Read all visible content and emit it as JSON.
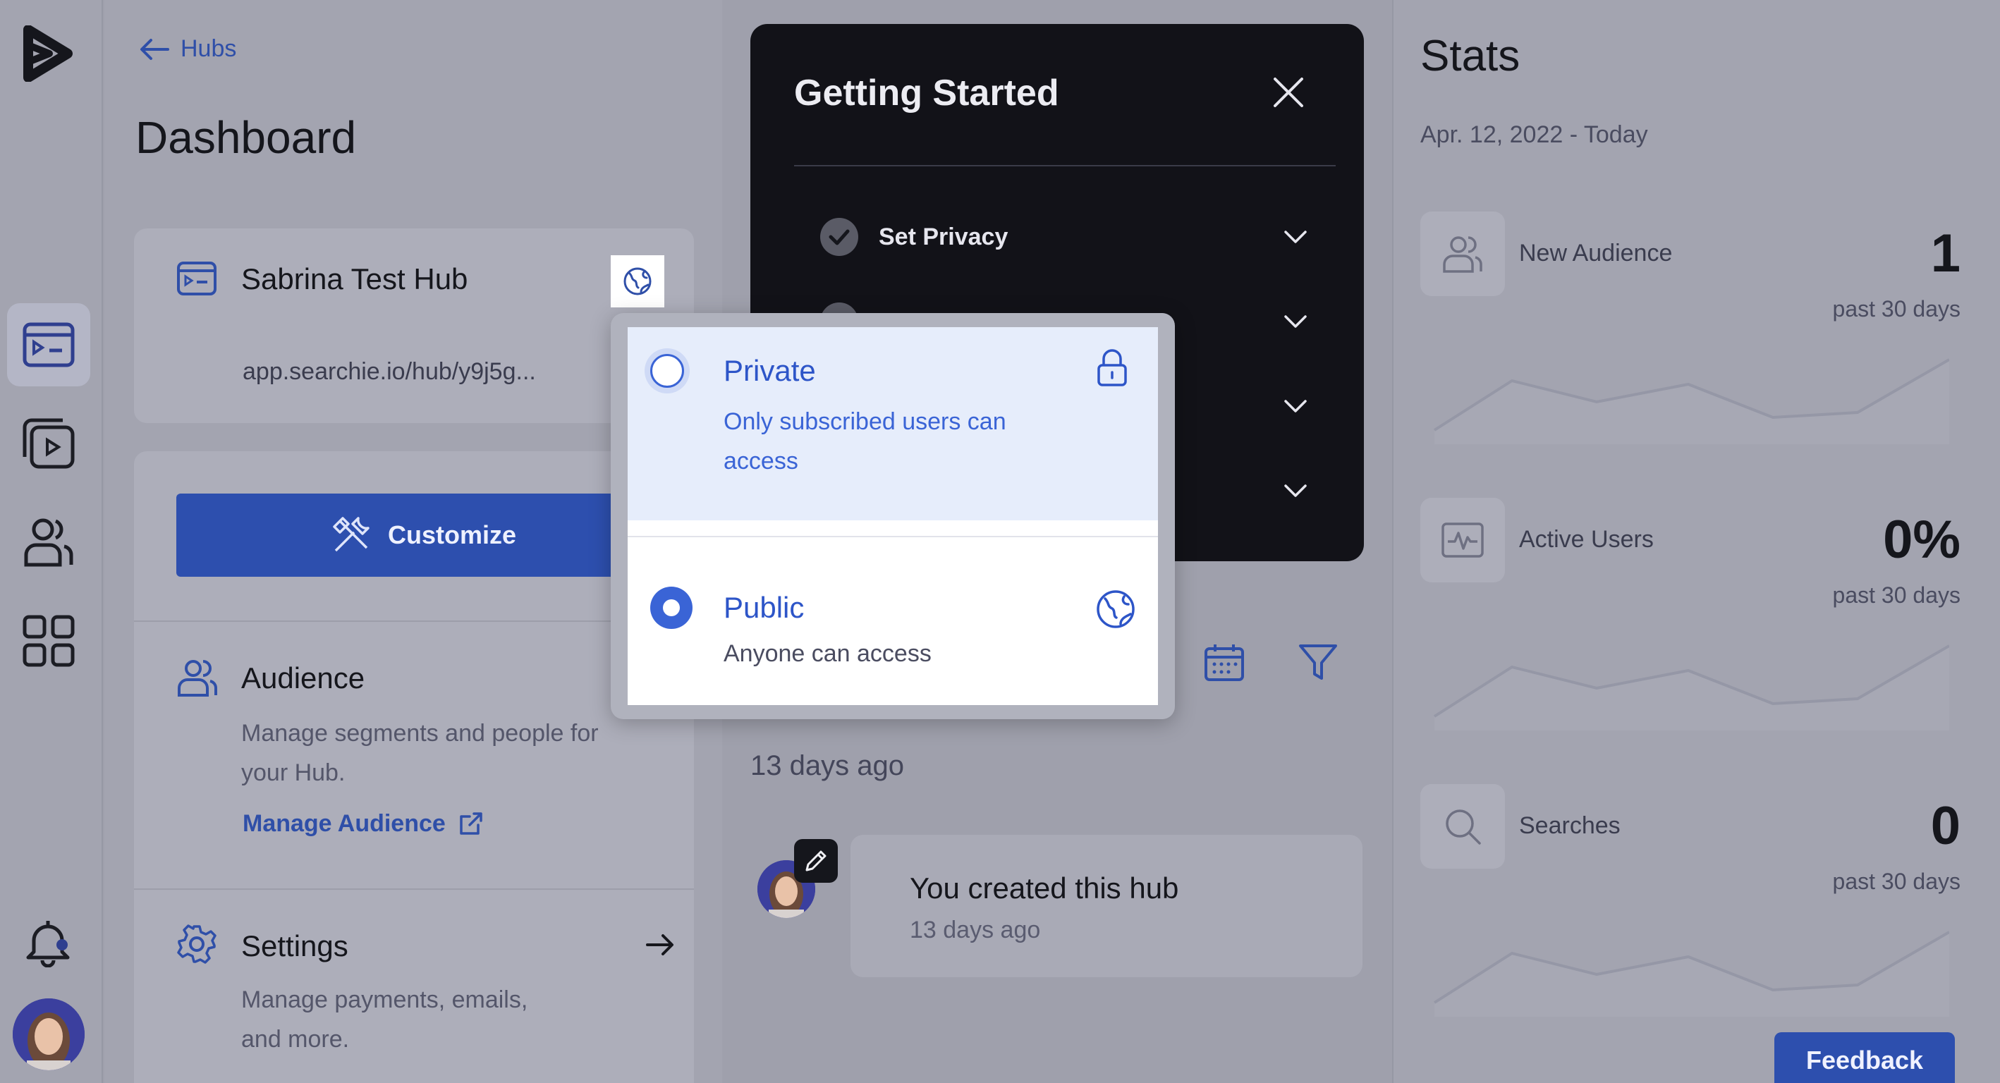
{
  "nav": {
    "back_label": "Hubs",
    "page_title": "Dashboard"
  },
  "hub": {
    "name": "Sabrina Test Hub",
    "url": "app.searchie.io/hub/y9j5g..."
  },
  "customize": {
    "label": "Customize"
  },
  "audience": {
    "title": "Audience",
    "desc_line1": "Manage segments and people for",
    "desc_line2": "your Hub.",
    "link": "Manage Audience"
  },
  "settings": {
    "title": "Settings",
    "desc_line1": "Manage payments, emails,",
    "desc_line2": "and more."
  },
  "getting_started": {
    "title": "Getting Started",
    "items": [
      {
        "label": "Set Privacy"
      }
    ]
  },
  "activity": {
    "group_label": "13 days ago",
    "item_title": "You created this hub",
    "item_time": "13 days ago"
  },
  "privacy_popup": {
    "private_title": "Private",
    "private_desc_line1": "Only subscribed users can",
    "private_desc_line2": "access",
    "public_title": "Public",
    "public_desc": "Anyone can access",
    "selected": "Public"
  },
  "stats": {
    "title": "Stats",
    "range": "Apr. 12, 2022 - Today",
    "items": [
      {
        "label": "New Audience",
        "value": "1",
        "period": "past 30 days",
        "icon": "users-icon"
      },
      {
        "label": "Active Users",
        "value": "0%",
        "period": "past 30 days",
        "icon": "activity-icon"
      },
      {
        "label": "Searches",
        "value": "0",
        "period": "past 30 days",
        "icon": "search-icon"
      }
    ]
  },
  "feedback": {
    "label": "Feedback"
  },
  "colors": {
    "accent": "#2d4fae",
    "link": "#2f4fa8",
    "dark_panel": "#121218",
    "popup_selected_bg": "#e6edfb"
  }
}
